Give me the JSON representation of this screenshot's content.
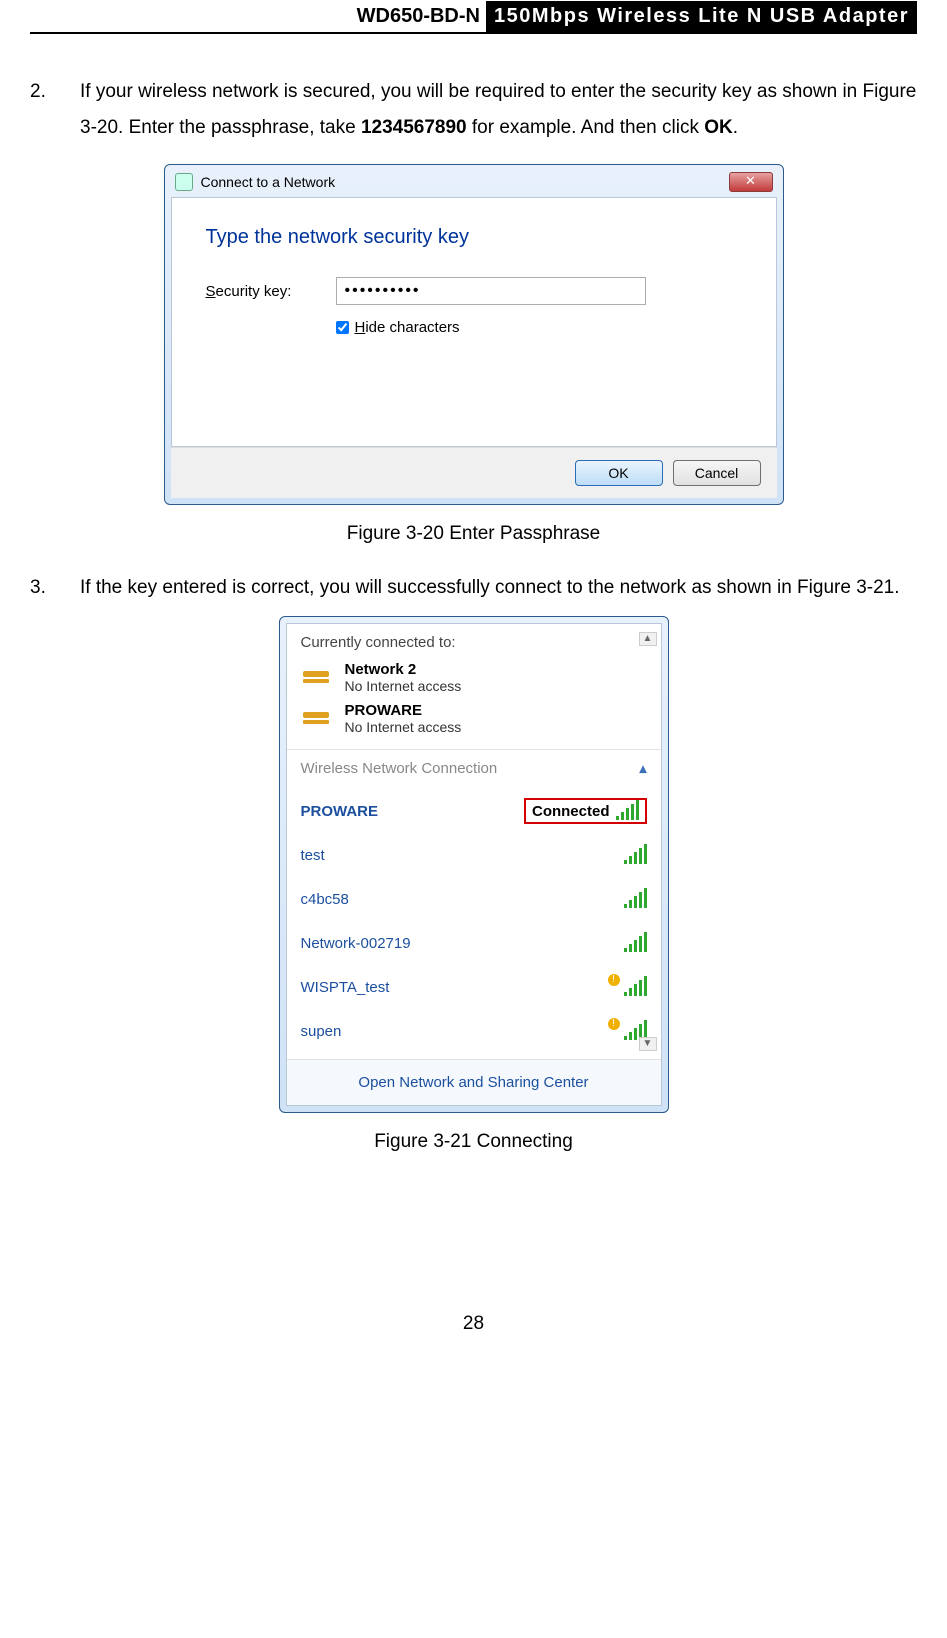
{
  "header": {
    "model": "WD650-BD-N",
    "title": "150Mbps Wireless Lite N USB Adapter"
  },
  "step2": {
    "num": "2.",
    "text_a": "If your wireless network is secured, you will be required to enter the security key as shown in Figure 3-20. Enter the passphrase, take ",
    "bold1": "1234567890",
    "text_b": " for example. And then click ",
    "bold2": "OK",
    "text_c": "."
  },
  "fig20": {
    "title": "Connect to a Network",
    "heading": "Type the network security key",
    "label_pre": "S",
    "label_post": "ecurity key:",
    "input_value": "••••••••••",
    "hide_pre": "H",
    "hide_post": "ide characters",
    "btn_ok": "OK",
    "btn_cancel": "Cancel",
    "caption": "Figure 3-20 Enter Passphrase"
  },
  "step3": {
    "num": "3.",
    "text": "If the key entered is correct, you will successfully connect to the network as shown in Figure 3-21."
  },
  "fig21": {
    "currently": "Currently connected to:",
    "conns": [
      {
        "name": "Network  2",
        "sub": "No Internet access"
      },
      {
        "name": "PROWARE",
        "sub": "No Internet access"
      }
    ],
    "wnc": "Wireless Network Connection",
    "status": "Connected",
    "nets": [
      "PROWARE",
      "test",
      "c4bc58",
      "Network-002719",
      "WISPTA_test",
      "supen"
    ],
    "open": "Open Network and Sharing Center",
    "caption": "Figure 3-21 Connecting"
  },
  "page_number": "28"
}
